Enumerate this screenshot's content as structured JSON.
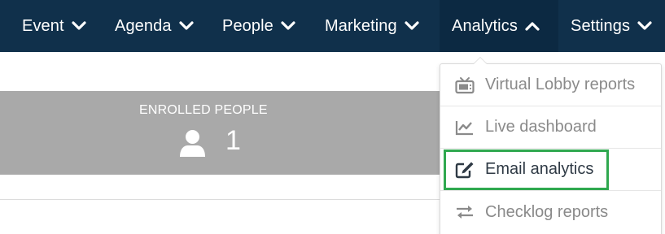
{
  "nav": {
    "items": [
      {
        "label": "Event",
        "expanded": false
      },
      {
        "label": "Agenda",
        "expanded": false
      },
      {
        "label": "People",
        "expanded": false
      },
      {
        "label": "Marketing",
        "expanded": false
      },
      {
        "label": "Analytics",
        "expanded": true
      },
      {
        "label": "Settings",
        "expanded": false
      }
    ]
  },
  "stats": {
    "enrolled_label": "ENROLLED PEOPLE",
    "enrolled_value": "1"
  },
  "analytics_menu": {
    "items": [
      {
        "label": "Virtual Lobby reports",
        "icon": "tv-icon"
      },
      {
        "label": "Live dashboard",
        "icon": "line-chart-icon"
      },
      {
        "label": "Email analytics",
        "icon": "edit-icon",
        "highlighted": true
      },
      {
        "label": "Checklog reports",
        "icon": "exchange-arrows-icon"
      }
    ]
  },
  "colors": {
    "nav_background": "#10304b",
    "stat_band": "#a9a9a9",
    "highlight_border": "#2fa84f",
    "menu_text": "#8a8a8a"
  }
}
